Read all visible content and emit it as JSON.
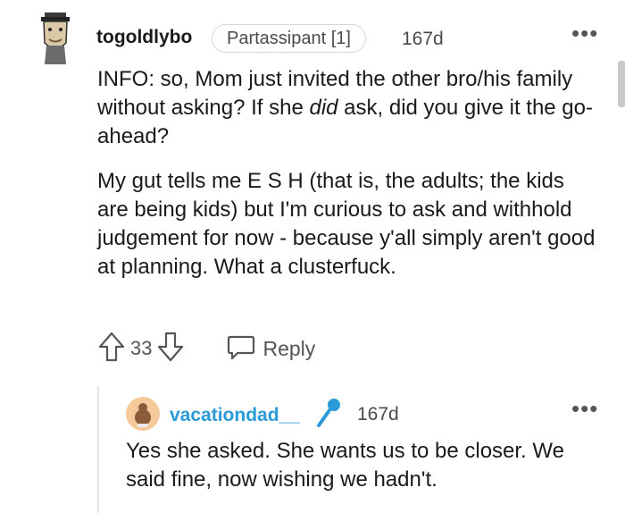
{
  "comment": {
    "username": "togoldlybo",
    "flair": "Partassipant [1]",
    "age": "167d",
    "more_icon": "more-horizontal-icon",
    "paragraph1": [
      {
        "text": "INFO: so, Mom just invited the other bro/his family without asking? If she ",
        "italic": false
      },
      {
        "text": "did",
        "italic": true
      },
      {
        "text": " ask, did you give it the go-ahead?",
        "italic": false
      }
    ],
    "paragraph2": "My gut tells me E S H (that is, the adults; the kids are being kids) but I'm curious to ask and withhold judgement for now - because y'all simply aren't good at planning. What a clusterfuck.",
    "vote_count": "33",
    "reply_label": "Reply",
    "icons": [
      "upvote-icon",
      "downvote-icon",
      "reply-bubble-icon"
    ]
  },
  "reply": {
    "username": "vacationdad__",
    "badge_icon": "microphone-icon",
    "age": "167d",
    "text": "Yes she asked. She wants us to be closer. We said fine, now wishing we hadn't.",
    "accent": "#2a9ad8"
  },
  "colors": {
    "username_reply": "#2a9ad8",
    "reply_avatar_bg": "#f6c99a",
    "text": "#1a1a1b",
    "meta": "#4a4a4a"
  }
}
